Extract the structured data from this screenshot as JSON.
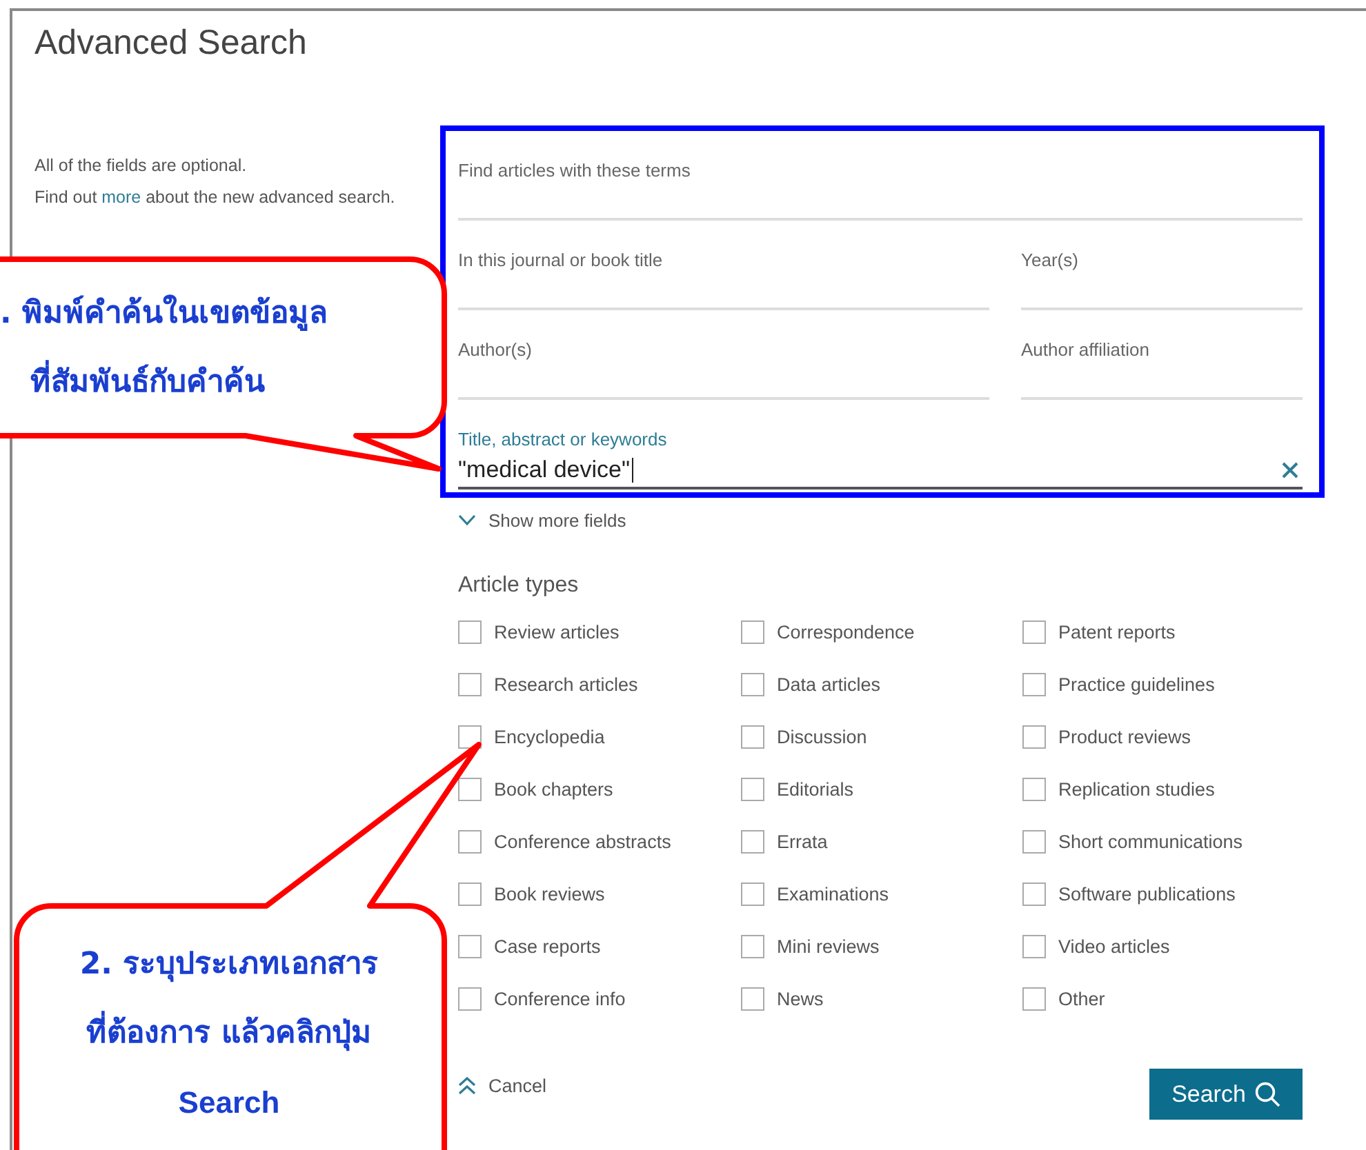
{
  "page": {
    "title": "Advanced Search"
  },
  "intro": {
    "line_1": "All of the fields are optional.",
    "line_2_before": "Find out ",
    "line_2_link": "more",
    "line_2_after": " about the new advanced search."
  },
  "field_rows": [
    [
      {
        "label": "Find articles with these terms",
        "focused": false
      }
    ],
    [
      {
        "label": "In this journal or book title",
        "focused": false
      },
      {
        "label": "Year(s)",
        "focused": false
      }
    ],
    [
      {
        "label": "Author(s)",
        "focused": false
      },
      {
        "label": "Author affiliation",
        "focused": false
      }
    ],
    [
      {
        "label": "Title, abstract or keywords",
        "focused": true,
        "value": "\"medical device\""
      }
    ]
  ],
  "show_more": {
    "label": "Show more fields"
  },
  "article_types": {
    "heading": "Article types",
    "items": [
      {
        "label": "Review articles",
        "checked": false
      },
      {
        "label": "Correspondence",
        "checked": false
      },
      {
        "label": "Patent reports",
        "checked": false
      },
      {
        "label": "Research articles",
        "checked": false
      },
      {
        "label": "Data articles",
        "checked": false
      },
      {
        "label": "Practice guidelines",
        "checked": false
      },
      {
        "label": "Encyclopedia",
        "checked": false
      },
      {
        "label": "Discussion",
        "checked": false
      },
      {
        "label": "Product reviews",
        "checked": false
      },
      {
        "label": "Book chapters",
        "checked": false
      },
      {
        "label": "Editorials",
        "checked": false
      },
      {
        "label": "Replication studies",
        "checked": false
      },
      {
        "label": "Conference abstracts",
        "checked": false
      },
      {
        "label": "Errata",
        "checked": false
      },
      {
        "label": "Short communications",
        "checked": false
      },
      {
        "label": "Book reviews",
        "checked": false
      },
      {
        "label": "Examinations",
        "checked": false
      },
      {
        "label": "Software publications",
        "checked": false
      },
      {
        "label": "Case reports",
        "checked": false
      },
      {
        "label": "Mini reviews",
        "checked": false
      },
      {
        "label": "Video articles",
        "checked": false
      },
      {
        "label": "Conference info",
        "checked": false
      },
      {
        "label": "News",
        "checked": false
      },
      {
        "label": "Other",
        "checked": false
      }
    ]
  },
  "cancel": {
    "label": "Cancel"
  },
  "search_button": {
    "label": "Search"
  },
  "callouts": [
    {
      "lines": [
        ". พิมพ์คำค้นในเขตข้อมูล",
        "ที่สัมพันธ์กับคำค้น"
      ]
    },
    {
      "lines": [
        "2. ระบุประเภทเอกสาร",
        "ที่ต้องการ แล้วคลิกปุ่ม",
        "Search"
      ]
    }
  ]
}
